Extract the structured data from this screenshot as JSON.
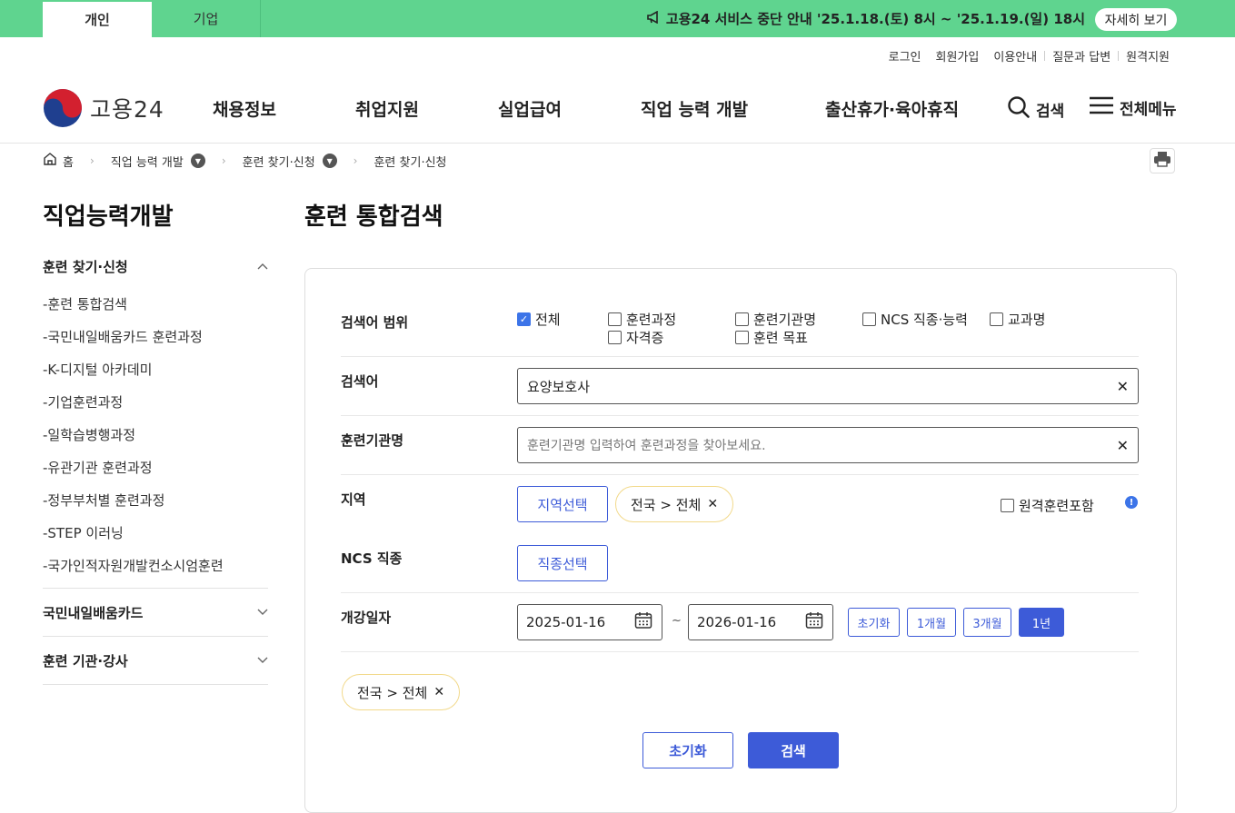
{
  "topbar": {
    "tabs": [
      "개인",
      "기업"
    ],
    "notice": "고용24 서비스 중단 안내 '25.1.18.(토) 8시 ~ '25.1.19.(일) 18시",
    "detail_button": "자세히 보기"
  },
  "util_links": [
    "로그인",
    "회원가입",
    "이용안내",
    "질문과 답변",
    "원격지원"
  ],
  "header": {
    "logo_text": "고용24",
    "nav": [
      "채용정보",
      "취업지원",
      "실업급여",
      "직업 능력 개발",
      "출산휴가·육아휴직"
    ],
    "search_label": "검색",
    "menu_label": "전체메뉴"
  },
  "breadcrumb": [
    "홈",
    "직업 능력 개발",
    "훈련 찾기·신청",
    "훈련 찾기·신청"
  ],
  "sidebar": {
    "title": "직업능력개발",
    "section1": "훈련 찾기·신청",
    "items": [
      "-훈련 통합검색",
      "-국민내일배움카드 훈련과정",
      "-K-디지털 아카데미",
      "-기업훈련과정",
      "-일학습병행과정",
      "-유관기관 훈련과정",
      "-정부부처별 훈련과정",
      "-STEP 이러닝",
      "-국가인적자원개발컨소시엄훈련"
    ],
    "section2": "국민내일배움카드",
    "section3": "훈련 기관·강사"
  },
  "main": {
    "title": "훈련 통합검색",
    "labels": {
      "scope": "검색어 범위",
      "keyword": "검색어",
      "institution": "훈련기관명",
      "region": "지역",
      "ncs": "NCS 직종",
      "date": "개강일자"
    },
    "scope_options": [
      "전체",
      "훈련과정",
      "훈련기관명",
      "NCS 직종·능력",
      "교과명",
      "자격증",
      "훈련 목표"
    ],
    "keyword_value": "요양보호사",
    "institution_placeholder": "훈련기관명 입력하여 훈련과정을 찾아보세요.",
    "region_button": "지역선택",
    "region_chip": "전국 > 전체",
    "remote_label": "원격훈련포함",
    "ncs_button": "직종선택",
    "date_from": "2025-01-16",
    "date_to": "2026-01-16",
    "tilde": "~",
    "period_buttons": [
      "초기화",
      "1개월",
      "3개월",
      "1년"
    ],
    "selected_chip": "전국 > 전체",
    "reset_button": "초기화",
    "search_button": "검색"
  }
}
